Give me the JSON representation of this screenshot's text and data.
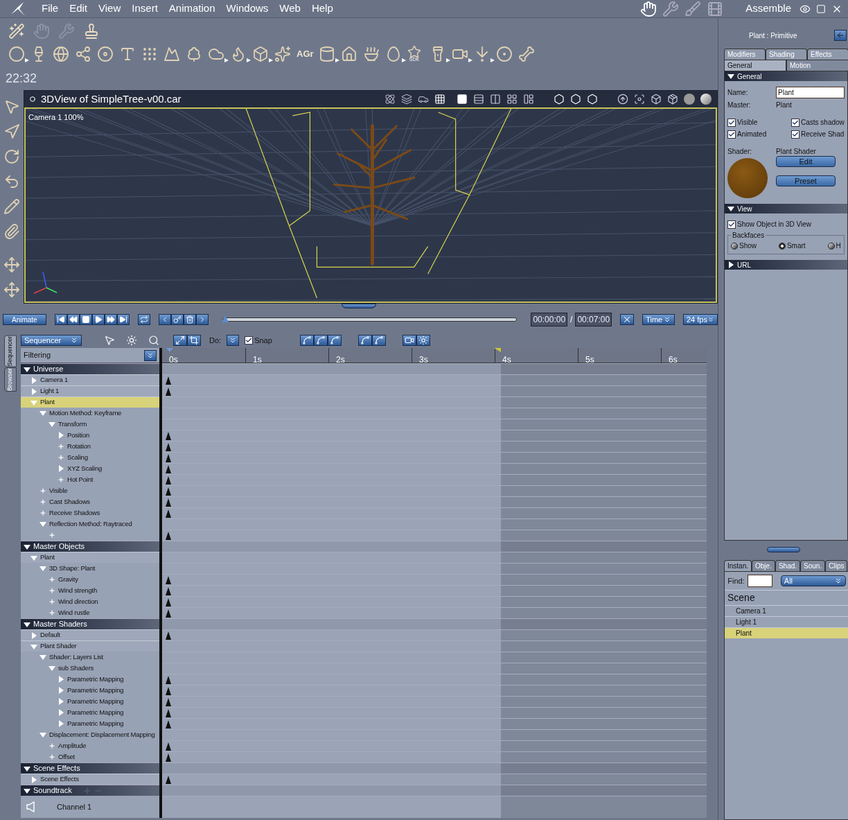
{
  "menu": {
    "items": [
      "File",
      "Edit",
      "View",
      "Insert",
      "Animation",
      "Windows",
      "Web",
      "Help"
    ],
    "workspace": "Assemble"
  },
  "object_tools": [
    {
      "kind": "icon",
      "submenu": true
    },
    {
      "kind": "icon",
      "submenu": false
    },
    {
      "kind": "icon",
      "submenu": false
    },
    {
      "kind": "icon",
      "submenu": false
    },
    {
      "kind": "icon",
      "submenu": false
    },
    {
      "kind": "icon",
      "submenu": false
    },
    {
      "kind": "icon",
      "submenu": false
    },
    {
      "kind": "icon",
      "submenu": false
    },
    {
      "kind": "icon",
      "submenu": false
    },
    {
      "kind": "icon",
      "submenu": true
    },
    {
      "kind": "icon",
      "submenu": true
    },
    {
      "kind": "icon",
      "submenu": true
    },
    {
      "kind": "icon",
      "submenu": false
    },
    {
      "kind": "text",
      "label": "AGr",
      "submenu": false
    },
    {
      "kind": "icon",
      "submenu": true
    },
    {
      "kind": "icon",
      "submenu": false
    },
    {
      "kind": "icon",
      "submenu": false
    },
    {
      "kind": "icon",
      "submenu": true
    },
    {
      "kind": "badge",
      "label": "SDK",
      "submenu": false
    },
    {
      "kind": "icon",
      "submenu": true
    },
    {
      "kind": "icon",
      "submenu": true
    },
    {
      "kind": "icon",
      "submenu": true
    },
    {
      "kind": "icon",
      "submenu": false
    },
    {
      "kind": "icon",
      "submenu": false
    }
  ],
  "clock": "22:32",
  "viewport": {
    "title": "3DView of SimpleTree-v00.car",
    "camera_label": "Camera 1 100%"
  },
  "transport": {
    "animate": "Animate",
    "level": 0,
    "start_time": "00:00:00",
    "separator": "/",
    "end_time": "00:07:00",
    "time_mode": "Time",
    "fps": "24 fps"
  },
  "sequencer": {
    "side_tabs": [
      {
        "label": "Sequencer",
        "selected": true
      },
      {
        "label": "Browser",
        "selected": false
      }
    ],
    "mode": "Sequencer",
    "do_label": "Do:",
    "snap": {
      "label": "Snap",
      "checked": true
    },
    "filtering": "Filtering",
    "ruler": [
      "0s",
      "1s",
      "2s",
      "3s",
      "4s",
      "5s",
      "6s"
    ],
    "range": {
      "level": 0.622
    },
    "tree": [
      {
        "kind": "group",
        "label": "Universe",
        "expanded": true,
        "children": [
          {
            "kind": "branch",
            "label": "Camera 1",
            "expanded": false,
            "selected": false,
            "keyframe": true
          },
          {
            "kind": "branch",
            "label": "Light 1",
            "expanded": false,
            "selected": false,
            "keyframe": true
          },
          {
            "kind": "branch",
            "label": "Plant",
            "expanded": true,
            "selected": true,
            "keyframe": false,
            "children": [
              {
                "kind": "branch",
                "label": "Motion Method: Keyframe",
                "expanded": true,
                "selected": false,
                "keyframe": false,
                "children": [
                  {
                    "kind": "branch",
                    "label": "Transform",
                    "expanded": true,
                    "selected": false,
                    "keyframe": false,
                    "children": [
                      {
                        "kind": "branch",
                        "label": "Position",
                        "expanded": false,
                        "selected": false,
                        "keyframe": true
                      },
                      {
                        "kind": "leaf",
                        "label": "Rotation",
                        "selected": false,
                        "keyframe": true
                      },
                      {
                        "kind": "leaf",
                        "label": "Scaling",
                        "selected": false,
                        "keyframe": true
                      },
                      {
                        "kind": "branch",
                        "label": "XYZ Scaling",
                        "expanded": false,
                        "selected": false,
                        "keyframe": true
                      },
                      {
                        "kind": "leaf",
                        "label": "Hot Point",
                        "selected": false,
                        "keyframe": true
                      }
                    ]
                  }
                ]
              },
              {
                "kind": "leaf",
                "label": "Visible",
                "selected": false,
                "keyframe": true
              },
              {
                "kind": "leaf",
                "label": "Cast Shadows",
                "selected": false,
                "keyframe": true
              },
              {
                "kind": "leaf",
                "label": "Receive Shadows",
                "selected": false,
                "keyframe": true
              },
              {
                "kind": "branch",
                "label": "Reflection Method: Raytraced",
                "expanded": true,
                "selected": false,
                "keyframe": false,
                "children": [
                  {
                    "kind": "leaf",
                    "selected": false,
                    "keyframe": true
                  }
                ]
              }
            ]
          }
        ]
      },
      {
        "kind": "group",
        "label": "Master Objects",
        "expanded": true,
        "children": [
          {
            "kind": "branch",
            "label": "Plant",
            "expanded": true,
            "selected": false,
            "keyframe": false,
            "children": [
              {
                "kind": "branch",
                "label": "3D Shape: Plant",
                "expanded": true,
                "selected": false,
                "keyframe": false,
                "children": [
                  {
                    "kind": "leaf",
                    "label": "Gravity",
                    "selected": false,
                    "keyframe": true
                  },
                  {
                    "kind": "leaf",
                    "label": "Wind strength",
                    "selected": false,
                    "keyframe": true
                  },
                  {
                    "kind": "leaf",
                    "label": "Wind direction",
                    "selected": false,
                    "keyframe": true
                  },
                  {
                    "kind": "leaf",
                    "label": "Wind rustle",
                    "selected": false,
                    "keyframe": true
                  }
                ]
              }
            ]
          }
        ]
      },
      {
        "kind": "group",
        "label": "Master Shaders",
        "expanded": true,
        "children": [
          {
            "kind": "branch",
            "label": "Default",
            "expanded": false,
            "selected": false,
            "keyframe": true
          },
          {
            "kind": "branch",
            "label": "Plant Shader",
            "expanded": true,
            "selected": false,
            "keyframe": false,
            "children": [
              {
                "kind": "branch",
                "label": "Shader: Layers List",
                "expanded": true,
                "selected": false,
                "keyframe": false,
                "children": [
                  {
                    "kind": "branch",
                    "label": "sub Shaders",
                    "expanded": true,
                    "selected": false,
                    "keyframe": false,
                    "children": [
                      {
                        "kind": "branch",
                        "label": "Parametric Mapping",
                        "expanded": false,
                        "selected": false,
                        "keyframe": true
                      },
                      {
                        "kind": "branch",
                        "label": "Parametric Mapping",
                        "expanded": false,
                        "selected": false,
                        "keyframe": true
                      },
                      {
                        "kind": "branch",
                        "label": "Parametric Mapping",
                        "expanded": false,
                        "selected": false,
                        "keyframe": true
                      },
                      {
                        "kind": "branch",
                        "label": "Parametric Mapping",
                        "expanded": false,
                        "selected": false,
                        "keyframe": true
                      },
                      {
                        "kind": "branch",
                        "label": "Parametric Mapping",
                        "expanded": false,
                        "selected": false,
                        "keyframe": true
                      }
                    ]
                  }
                ]
              },
              {
                "kind": "branch",
                "label": "Displacement: Displacement Mapping",
                "expanded": true,
                "selected": false,
                "keyframe": false,
                "children": [
                  {
                    "kind": "leaf",
                    "label": "Amplitude",
                    "selected": false,
                    "keyframe": true
                  },
                  {
                    "kind": "leaf",
                    "label": "Offset",
                    "selected": false,
                    "keyframe": true
                  }
                ]
              }
            ]
          }
        ]
      },
      {
        "kind": "group",
        "label": "Scene Effects",
        "expanded": true,
        "children": [
          {
            "kind": "branch",
            "label": "Scene Effects",
            "expanded": false,
            "selected": false,
            "keyframe": true
          }
        ]
      },
      {
        "kind": "soundtrack",
        "label": "Soundtrack",
        "expanded": true,
        "children": [
          {
            "kind": "channel",
            "label": "Channel 1",
            "selected": false,
            "keyframe": false
          }
        ]
      }
    ]
  },
  "inspector": {
    "title": "Plant : Primitive",
    "tabs_back": [
      {
        "label": "Modifiers",
        "selected": false
      },
      {
        "label": "Shading",
        "selected": false
      },
      {
        "label": "Effects",
        "selected": false
      }
    ],
    "tabs_front": [
      {
        "label": "General",
        "selected": true
      },
      {
        "label": "Motion",
        "selected": false
      }
    ],
    "general": {
      "header": "General",
      "expanded": true,
      "name_label": "Name:",
      "name_value": "Plant",
      "master_label": "Master:",
      "master_value": "Plant",
      "checks": [
        {
          "label": "Visible",
          "checked": true
        },
        {
          "label": "Casts shadow",
          "checked": true
        },
        {
          "label": "Animated",
          "checked": true
        },
        {
          "label": "Receive Shad",
          "checked": true
        }
      ],
      "shader_label": "Shader:",
      "shader_value": "Plant Shader",
      "buttons": [
        "Edit",
        "Preset"
      ]
    },
    "view": {
      "header": "View",
      "expanded": true,
      "show_object": {
        "label": "Show Object in 3D View",
        "checked": true
      },
      "backfaces": "Backfaces",
      "radios": [
        {
          "label": "Show",
          "selected": false
        },
        {
          "label": "Smart",
          "selected": true
        },
        {
          "label": "H",
          "selected": false
        }
      ]
    },
    "url": {
      "header": "URL",
      "expanded": false
    }
  },
  "browser": {
    "tabs": [
      {
        "label": "Instan.",
        "selected": true
      },
      {
        "label": "Obje.",
        "selected": false
      },
      {
        "label": "Shad.",
        "selected": false
      },
      {
        "label": "Soun.",
        "selected": false
      },
      {
        "label": "Clips",
        "selected": false
      }
    ],
    "find_label": "Find:",
    "filter": "All",
    "heading": "Scene",
    "items": [
      {
        "label": "Camera 1",
        "selected": false
      },
      {
        "label": "Light 1",
        "selected": false
      },
      {
        "label": "Plant",
        "selected": true
      }
    ]
  }
}
